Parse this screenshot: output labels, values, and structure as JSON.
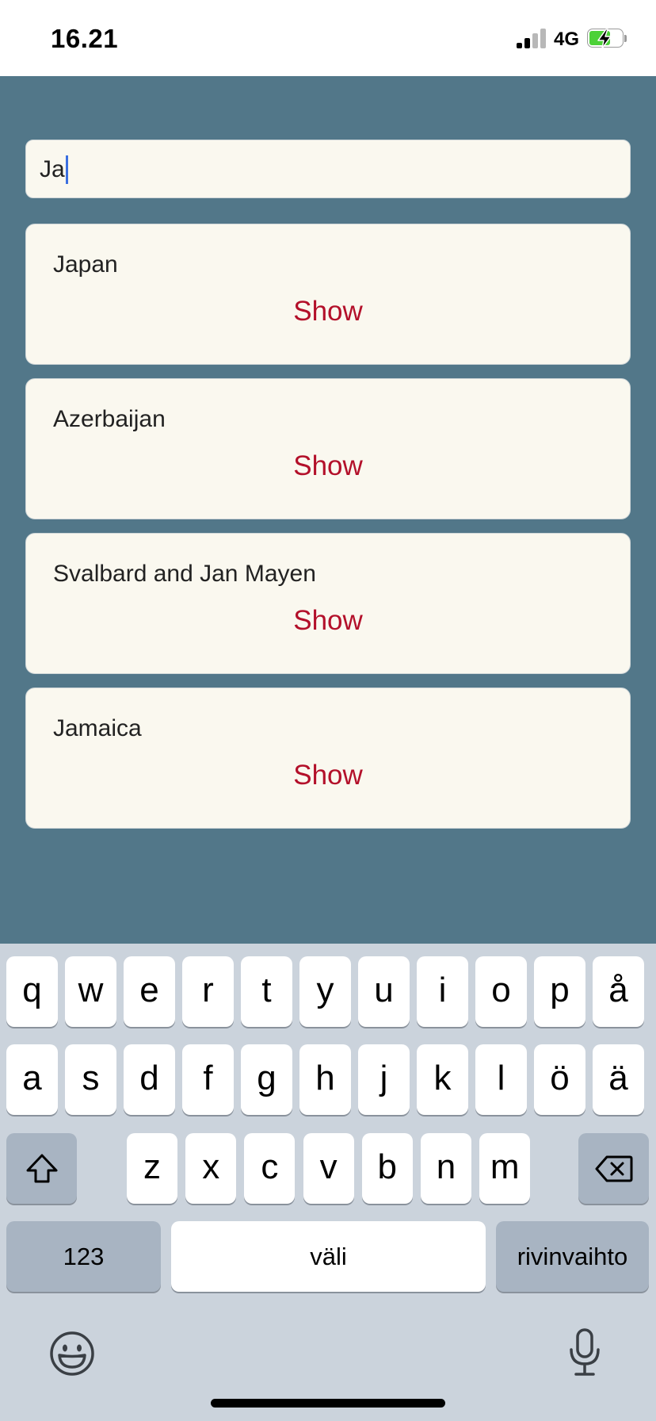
{
  "status_bar": {
    "time": "16.21",
    "network": "4G",
    "signal_bars_active": 2,
    "signal_bars_total": 4,
    "battery_charging": true
  },
  "search": {
    "value": "Ja"
  },
  "results": [
    {
      "name": "Japan",
      "action": "Show"
    },
    {
      "name": "Azerbaijan",
      "action": "Show"
    },
    {
      "name": "Svalbard and Jan Mayen",
      "action": "Show"
    },
    {
      "name": "Jamaica",
      "action": "Show"
    }
  ],
  "keyboard": {
    "row1": [
      "q",
      "w",
      "e",
      "r",
      "t",
      "y",
      "u",
      "i",
      "o",
      "p",
      "å"
    ],
    "row2": [
      "a",
      "s",
      "d",
      "f",
      "g",
      "h",
      "j",
      "k",
      "l",
      "ö",
      "ä"
    ],
    "row3": [
      "z",
      "x",
      "c",
      "v",
      "b",
      "n",
      "m"
    ],
    "numbers_label": "123",
    "space_label": "väli",
    "return_label": "rivinvaihto",
    "shift_icon": "shift-icon",
    "backspace_icon": "backspace-icon",
    "emoji_icon": "emoji-icon",
    "mic_icon": "microphone-icon"
  },
  "colors": {
    "app_background": "#527789",
    "card_background": "#faf8ef",
    "card_text": "#222222",
    "accent": "#b3102a",
    "keyboard_background": "#cbd3dc",
    "key_background": "#ffffff",
    "key_special": "#a8b4c2",
    "battery_green": "#4cd137",
    "caret": "#3b6fe0"
  }
}
